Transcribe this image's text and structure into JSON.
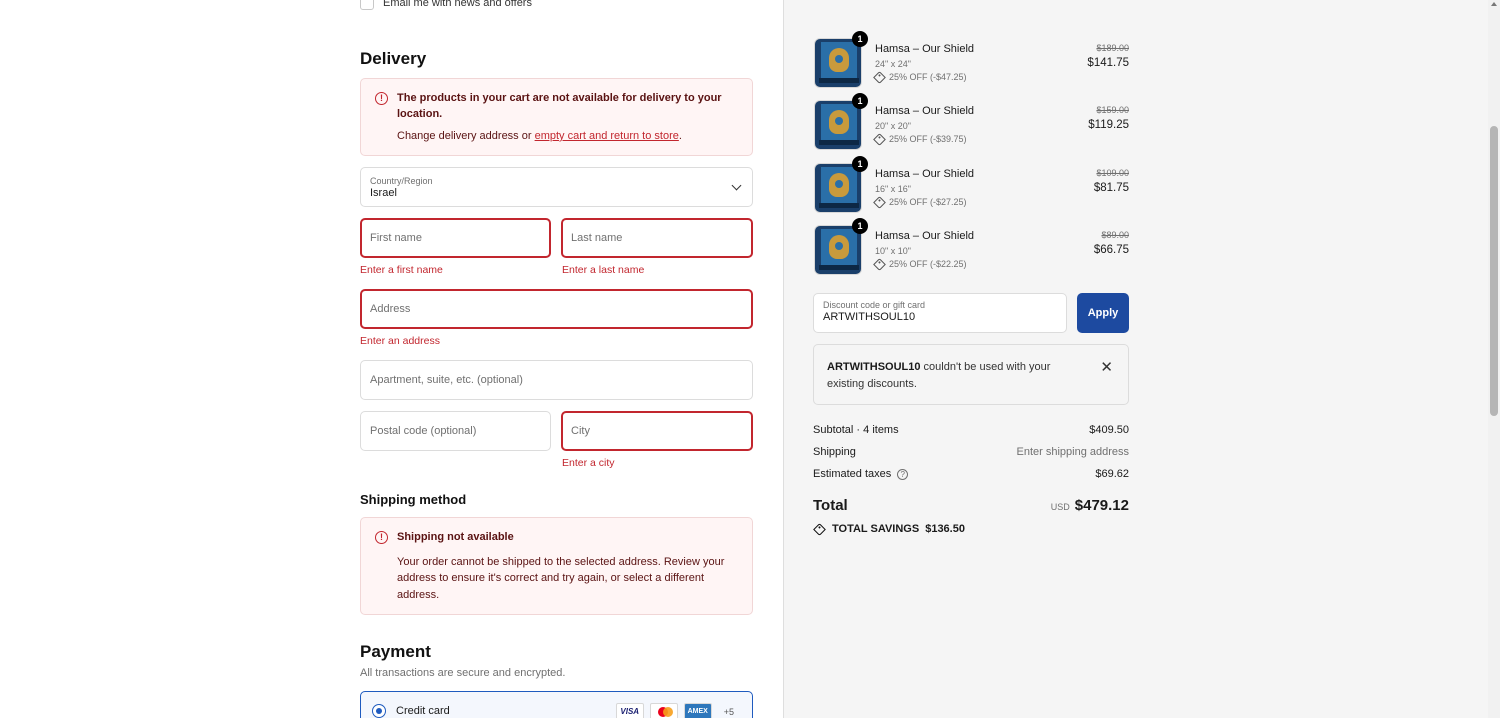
{
  "newsletter": {
    "label": "Email me with news and offers"
  },
  "delivery": {
    "heading": "Delivery",
    "alert": {
      "title": "The products in your cart are not available for delivery to your location.",
      "text_before": "Change delivery address or ",
      "link": "empty cart and return to store",
      "text_after": "."
    },
    "country": {
      "label": "Country/Region",
      "value": "Israel"
    },
    "first_name": {
      "placeholder": "First name",
      "error": "Enter a first name"
    },
    "last_name": {
      "placeholder": "Last name",
      "error": "Enter a last name"
    },
    "address": {
      "placeholder": "Address",
      "error": "Enter an address"
    },
    "apartment": {
      "placeholder": "Apartment, suite, etc. (optional)"
    },
    "postal": {
      "placeholder": "Postal code (optional)"
    },
    "city": {
      "placeholder": "City",
      "error": "Enter a city"
    }
  },
  "shipping_method": {
    "heading": "Shipping method",
    "alert": {
      "title": "Shipping not available",
      "text": "Your order cannot be shipped to the selected address. Review your address to ensure it's correct and try again, or select a different address."
    }
  },
  "payment": {
    "heading": "Payment",
    "subtitle": "All transactions are secure and encrypted.",
    "option": "Credit card",
    "cards": [
      "VISA",
      "Mastercard",
      "AMEX"
    ],
    "more": "+5"
  },
  "cart": {
    "items": [
      {
        "name": "Hamsa – Our Shield",
        "size": "24\" x 24\"",
        "discount": "25% OFF (-$47.25)",
        "original": "$189.00",
        "price": "$141.75",
        "qty": "1"
      },
      {
        "name": "Hamsa – Our Shield",
        "size": "20\" x 20\"",
        "discount": "25% OFF (-$39.75)",
        "original": "$159.00",
        "price": "$119.25",
        "qty": "1"
      },
      {
        "name": "Hamsa – Our Shield",
        "size": "16\" x 16\"",
        "discount": "25% OFF (-$27.25)",
        "original": "$109.00",
        "price": "$81.75",
        "qty": "1"
      },
      {
        "name": "Hamsa – Our Shield",
        "size": "10\" x 10\"",
        "discount": "25% OFF (-$22.25)",
        "original": "$89.00",
        "price": "$66.75",
        "qty": "1"
      }
    ]
  },
  "discount": {
    "label": "Discount code or gift card",
    "value": "ARTWITHSOUL10",
    "apply": "Apply",
    "notice_code": "ARTWITHSOUL10",
    "notice_text": " couldn't be used with your existing discounts.",
    "close": "✕"
  },
  "summary": {
    "subtotal_label": "Subtotal · 4 items",
    "subtotal_value": "$409.50",
    "shipping_label": "Shipping",
    "shipping_value": "Enter shipping address",
    "taxes_label": "Estimated taxes",
    "taxes_value": "$69.62",
    "total_label": "Total",
    "currency": "USD",
    "total_value": "$479.12",
    "savings_label": "TOTAL SAVINGS",
    "savings_value": "$136.50"
  },
  "colors": {
    "accent": "#1d4aa0",
    "error": "#c2262e",
    "sidebar_bg": "#f5f5f5"
  }
}
